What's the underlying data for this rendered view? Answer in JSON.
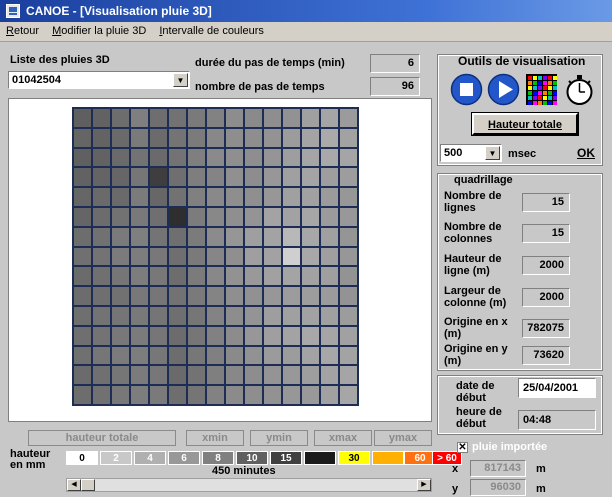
{
  "window": {
    "title": "CANOE  - [Visualisation  pluie 3D]"
  },
  "menu": [
    {
      "label": "Retour",
      "underline": "R",
      "rest": "etour"
    },
    {
      "label": "Modifier la pluie 3D",
      "underline": "M",
      "rest": "odifier la pluie 3D"
    },
    {
      "label": "Intervalle de couleurs",
      "underline": "I",
      "rest": "ntervalle de couleurs"
    }
  ],
  "rain_list": {
    "label": "Liste des pluies 3D",
    "selected": "01042504"
  },
  "timestep": {
    "label": "durée du pas de temps (min)",
    "value": "6"
  },
  "num_steps": {
    "label": "nombre de pas de temps",
    "value": "96"
  },
  "tools": {
    "title": "Outils de visualisation",
    "hauteur_totale_label": "Hauteur totale",
    "interval_value": "500",
    "interval_unit": "msec",
    "ok_label": "OK"
  },
  "quadrillage": {
    "title": "quadrillage",
    "rows": [
      {
        "label": "Nombre de lignes",
        "value": "15"
      },
      {
        "label": "Nombre de colonnes",
        "value": "15"
      },
      {
        "label": "Hauteur de ligne (m)",
        "value": "2000"
      },
      {
        "label": "Largeur de colonne (m)",
        "value": "2000"
      },
      {
        "label": "Origine en x (m)",
        "value": "782075"
      },
      {
        "label": "Origine en y (m)",
        "value": "73620"
      }
    ]
  },
  "dates": {
    "start_date_label": "date de début",
    "start_date": "25/04/2001",
    "start_time_label": "heure de début",
    "start_time": "04:48"
  },
  "legend_buttons": {
    "total": "hauteur totale",
    "xmin": "xmin",
    "ymin": "ymin",
    "xmax": "xmax",
    "ymax": "ymax"
  },
  "legend": {
    "label_line1": "hauteur",
    "label_line2": "en mm",
    "swatches": [
      {
        "label": "0",
        "bg": "#ffffff",
        "fg": "#000000"
      },
      {
        "label": "2",
        "bg": "#c8c8c8",
        "fg": "#ffffff"
      },
      {
        "label": "4",
        "bg": "#b0b0b0",
        "fg": "#ffffff"
      },
      {
        "label": "6",
        "bg": "#989898",
        "fg": "#ffffff"
      },
      {
        "label": "8",
        "bg": "#808080",
        "fg": "#ffffff"
      },
      {
        "label": "10",
        "bg": "#606060",
        "fg": "#ffffff"
      },
      {
        "label": "15",
        "bg": "#404040",
        "fg": "#ffffff"
      },
      {
        "label": "",
        "bg": "#1a1a1a",
        "fg": "#ffffff"
      },
      {
        "label": "30",
        "bg": "#ffff00",
        "fg": "#000000"
      },
      {
        "label": "",
        "bg": "#ffb000",
        "fg": "#000000"
      },
      {
        "label": "60",
        "bg": "#ff7010",
        "fg": "#ffffff"
      },
      {
        "label": "> 60",
        "bg": "#ff0000",
        "fg": "#ffffff"
      }
    ],
    "time_label": "450 minutes",
    "time_progress": 0.0
  },
  "imported": {
    "label": "pluie importée",
    "checked": true,
    "x_label": "x",
    "x_value": "817143",
    "y_label": "y",
    "y_value": "96030",
    "unit": "m"
  },
  "colors": {
    "grid_line": "#1d2d55",
    "title_bar": "#1a3f9e"
  },
  "cell_grays": [
    [
      "#5f5f5f",
      "#626262",
      "#6d6d6d",
      "#7f7f7f",
      "#6e6e6e",
      "#727272",
      "#7a7a7a",
      "#828282",
      "#8d8d8d",
      "#8a8a8a",
      "#8e8e8e",
      "#929292",
      "#a0a0a0",
      "#a5a5a5",
      "#9b9b9b"
    ],
    [
      "#656565",
      "#636363",
      "#6a6a6a",
      "#7a7a7a",
      "#6b6b6b",
      "#747474",
      "#7b7b7b",
      "#888888",
      "#8e8e8e",
      "#8e8e8e",
      "#939393",
      "#9c9c9c",
      "#a4a4a4",
      "#aaaaaa",
      "#a2a2a2"
    ],
    [
      "#606060",
      "#626262",
      "#6a6a6a",
      "#737373",
      "#6a6a6a",
      "#737373",
      "#7f7f7f",
      "#8a8a8a",
      "#8f8f8f",
      "#8e8e8e",
      "#959595",
      "#9e9e9e",
      "#a5a5a5",
      "#a9a9a9",
      "#a5a5a5"
    ],
    [
      "#626262",
      "#646464",
      "#666666",
      "#767676",
      "#3e3e3e",
      "#6f6f6f",
      "#7e7e7e",
      "#848484",
      "#909090",
      "#8d8d8d",
      "#979797",
      "#a0a0a0",
      "#a4a4a4",
      "#9e9e9e",
      "#9d9d9d"
    ],
    [
      "#666666",
      "#6a6a6a",
      "#6a6a6a",
      "#7b7b7b",
      "#676767",
      "#727272",
      "#808080",
      "#898989",
      "#8e8e8e",
      "#8f8f8f",
      "#979797",
      "#a0a0a0",
      "#a1a1a1",
      "#9b9b9b",
      "#979797"
    ],
    [
      "#656565",
      "#6c6c6c",
      "#727272",
      "#797979",
      "#6f6f6f",
      "#2e2e2e",
      "#7c7c7c",
      "#888888",
      "#8f8f8f",
      "#949494",
      "#a3a3a3",
      "#a2a2a2",
      "#a6a6a6",
      "#9b9b9b",
      "#989898"
    ],
    [
      "#6d6d6d",
      "#717171",
      "#7a7a7a",
      "#7f7f7f",
      "#747474",
      "#6f6f6f",
      "#7b7b7b",
      "#8b8b8b",
      "#969696",
      "#9f9f9f",
      "#a3a3a3",
      "#b8b8b8",
      "#a7a7a7",
      "#a0a0a0",
      "#959595"
    ],
    [
      "#707070",
      "#737373",
      "#7b7b7b",
      "#7d7d7d",
      "#787878",
      "#6f6f6f",
      "#7a7a7a",
      "#868686",
      "#8f8f8f",
      "#9f9f9f",
      "#a2a2a2",
      "#cfcfcf",
      "#a8a8a8",
      "#9f9f9f",
      "#979797"
    ],
    [
      "#6b6b6b",
      "#707070",
      "#767676",
      "#7d7d7d",
      "#787878",
      "#6d6d6d",
      "#7b7b7b",
      "#888888",
      "#929292",
      "#999999",
      "#a1a1a1",
      "#a4a4a4",
      "#a2a2a2",
      "#9f9f9f",
      "#939393"
    ],
    [
      "#6c6c6c",
      "#6f6f6f",
      "#717171",
      "#787878",
      "#767676",
      "#727272",
      "#7a7a7a",
      "#848484",
      "#8f8f8f",
      "#919191",
      "#979797",
      "#9c9c9c",
      "#9d9d9d",
      "#9b9b9b",
      "#939393"
    ],
    [
      "#6f6f6f",
      "#737373",
      "#757575",
      "#797979",
      "#757575",
      "#6f6f6f",
      "#767676",
      "#838383",
      "#8d8d8d",
      "#949494",
      "#9e9e9e",
      "#a0a0a0",
      "#a2a2a2",
      "#a0a0a0",
      "#9c9c9c"
    ],
    [
      "#6f6f6f",
      "#737373",
      "#787878",
      "#7b7b7b",
      "#767676",
      "#6c6c6c",
      "#767676",
      "#818181",
      "#8c8c8c",
      "#979797",
      "#9f9f9f",
      "#a3a3a3",
      "#a8a8a8",
      "#a5a5a5",
      "#a1a1a1"
    ],
    [
      "#707070",
      "#767676",
      "#7b7b7b",
      "#7d7d7d",
      "#777777",
      "#6d6d6d",
      "#777777",
      "#808080",
      "#8a8a8a",
      "#929292",
      "#9b9b9b",
      "#9c9c9c",
      "#a3a3a3",
      "#a7a7a7",
      "#a3a3a3"
    ],
    [
      "#6b6b6b",
      "#707070",
      "#767676",
      "#7b7b7b",
      "#777777",
      "#6a6a6a",
      "#737373",
      "#7f7f7f",
      "#888888",
      "#8d8d8d",
      "#949494",
      "#989898",
      "#9e9e9e",
      "#a3a3a3",
      "#a5a5a5"
    ],
    [
      "#6d6d6d",
      "#717171",
      "#787878",
      "#7d7d7d",
      "#7a7a7a",
      "#6e6e6e",
      "#757575",
      "#828282",
      "#8b8b8b",
      "#8e8e8e",
      "#929292",
      "#979797",
      "#999999",
      "#a1a1a1",
      "#a6a6a6"
    ]
  ]
}
